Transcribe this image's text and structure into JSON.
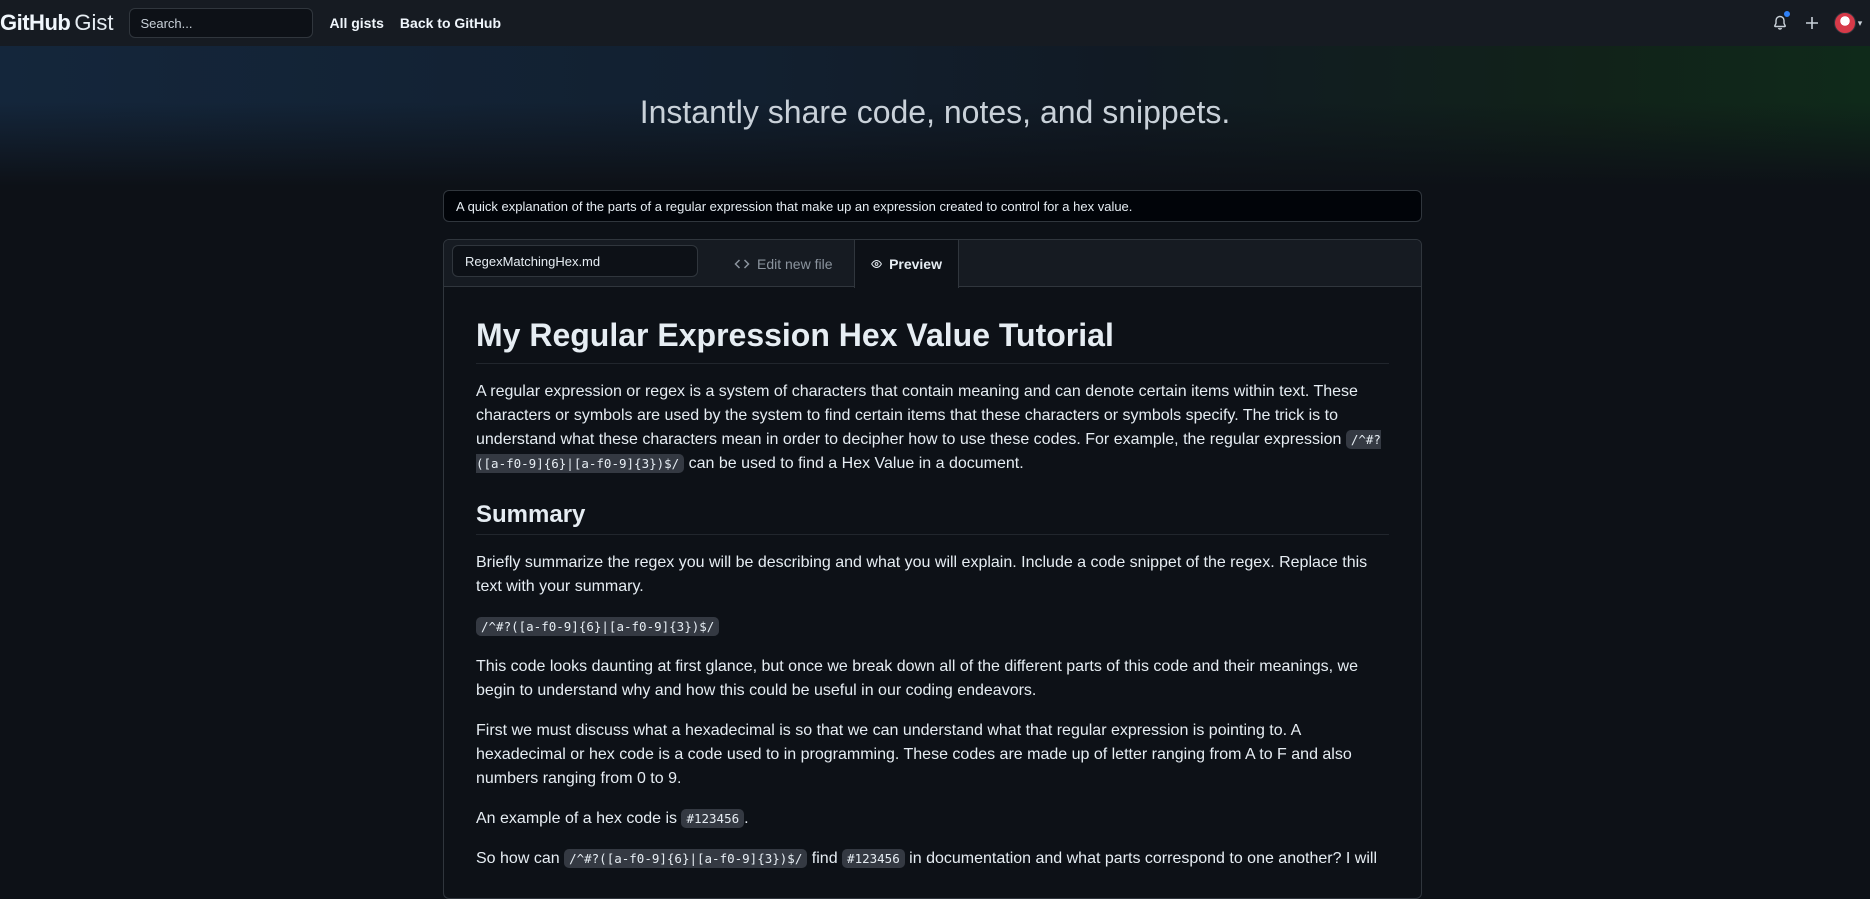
{
  "topbar": {
    "logo_main": "GitHub",
    "logo_sub": "Gist",
    "search_placeholder": "Search...",
    "links": [
      "All gists",
      "Back to GitHub"
    ]
  },
  "hero": {
    "title": "Instantly share code, notes, and snippets."
  },
  "gist": {
    "description": "A quick explanation of the parts of a regular expression that make up an expression created to control for a hex value.",
    "filename": "RegexMatchingHex.md",
    "tabs": {
      "edit": "Edit new file",
      "preview": "Preview"
    }
  },
  "markdown": {
    "h1": "My Regular Expression Hex Value Tutorial",
    "p1_a": "A regular expression or regex is a system of characters that contain meaning and can denote certain items within text. These characters or symbols are used by the system to find certain items that these characters or symbols specify. The trick is to understand what these characters mean in order to decipher how to use these codes. For example, the regular expression ",
    "p1_code": "/^#?([a-f0-9]{6}|[a-f0-9]{3})$/",
    "p1_b": " can be used to find a Hex Value in a document.",
    "h2": "Summary",
    "p2": "Briefly summarize the regex you will be describing and what you will explain. Include a code snippet of the regex. Replace this text with your summary.",
    "code_block": "/^#?([a-f0-9]{6}|[a-f0-9]{3})$/",
    "p3": "This code looks daunting at first glance, but once we break down all of the different parts of this code and their meanings, we begin to understand why and how this could be useful in our coding endeavors.",
    "p4": "First we must discuss what a hexadecimal is so that we can understand what that regular expression is pointing to. A hexadecimal or hex code is a code used to in programming. These codes are made up of letter ranging from A to F and also numbers ranging from 0 to 9.",
    "p5_a": "An example of a hex code is ",
    "p5_code": "#123456",
    "p5_b": ".",
    "p6_a": "So how can ",
    "p6_code1": "/^#?([a-f0-9]{6}|[a-f0-9]{3})$/",
    "p6_b": " find ",
    "p6_code2": "#123456",
    "p6_c": " in documentation and what parts correspond to one another? I will"
  }
}
